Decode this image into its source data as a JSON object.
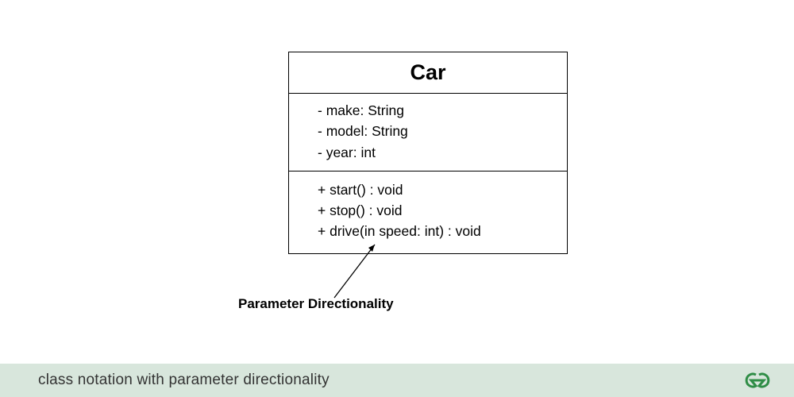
{
  "class": {
    "name": "Car",
    "attributes": [
      "- make: String",
      "- model: String",
      "- year: int"
    ],
    "methods": [
      "+ start() : void",
      "+ stop() : void",
      "+ drive(in speed: int) : void"
    ]
  },
  "annotation": "Parameter Directionality",
  "caption": "class notation with parameter directionality",
  "colors": {
    "caption_bg": "#d8e6dc",
    "logo": "#2f8d46"
  }
}
